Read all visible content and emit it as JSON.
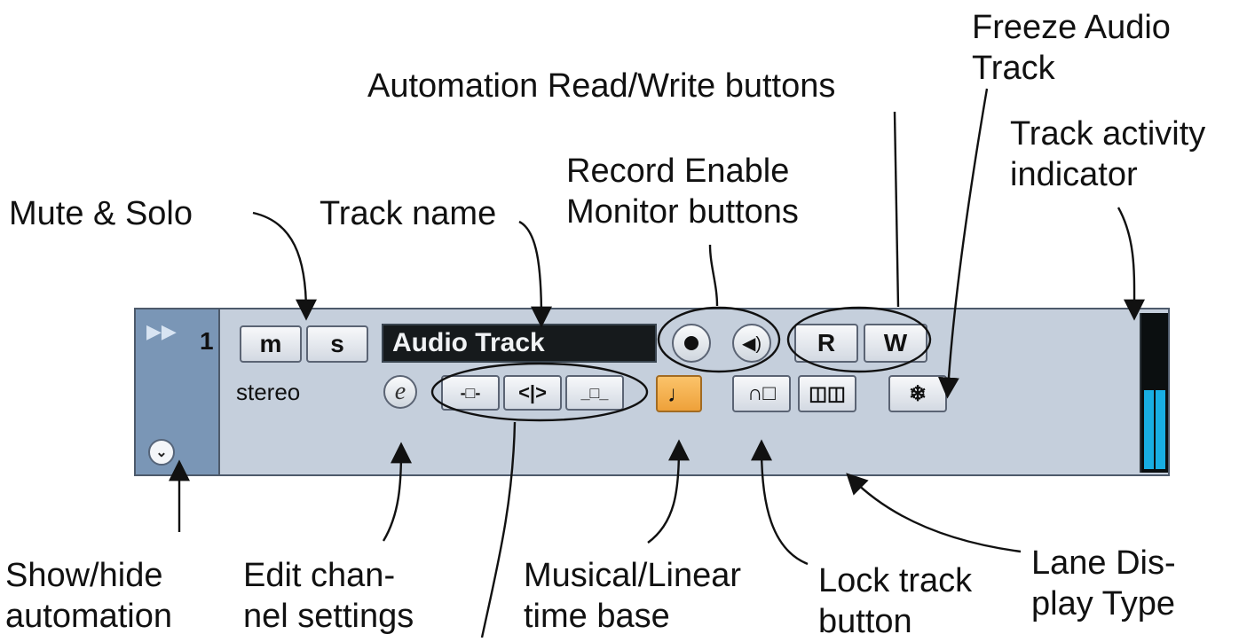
{
  "labels": {
    "freeze_line1": "Freeze Audio",
    "freeze_line2": "Track",
    "automation_rw": "Automation Read/Write buttons",
    "activity_line1": "Track activity",
    "activity_line2": "indicator",
    "record_line1": "Record Enable",
    "record_line2": "Monitor buttons",
    "mute_solo": "Mute & Solo",
    "track_name": "Track name",
    "showhide_line1": "Show/hide",
    "showhide_line2": "automation",
    "edit_line1": "Edit chan-",
    "edit_line2": "nel settings",
    "musical_line1": "Musical/Linear",
    "musical_line2": "time base",
    "lock_line1": "Lock track",
    "lock_line2": "button",
    "lane_line1": "Lane Dis-",
    "lane_line2": "play Type"
  },
  "track": {
    "number": "1",
    "name": "Audio Track",
    "channel": "stereo",
    "mute_label": "m",
    "solo_label": "s",
    "read_label": "R",
    "write_label": "W",
    "edit_label": "e",
    "meter_levels": [
      0.52,
      0.52
    ]
  },
  "icons": {
    "expand": "double-triangle-icon",
    "showhide": "chevron-down-icon",
    "record": "record-dot-icon",
    "monitor": "speaker-icon",
    "inserts": "inserts-icon",
    "eq": "eq-icon",
    "sends": "sends-icon",
    "timebase": "note-icon",
    "lock": "lock-icon",
    "lane": "lane-icon",
    "freeze": "snowflake-icon"
  },
  "colors": {
    "timebase_active": "#f1a742",
    "meter_fill": "#18aee3",
    "track_bg": "#c5cfdc"
  }
}
